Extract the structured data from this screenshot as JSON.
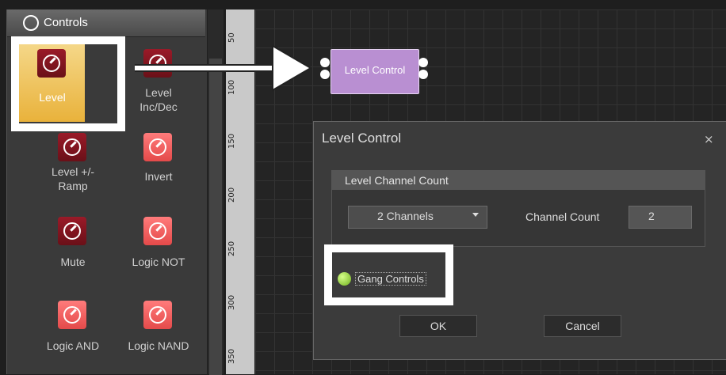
{
  "panel": {
    "title": "Controls",
    "tiles": [
      {
        "label": "Level",
        "icon": "level-knob-icon"
      },
      {
        "label": "Level\nInc/Dec",
        "icon": "level-knob-icon"
      },
      {
        "label": "Level +/-\nRamp",
        "icon": "level-knob-icon"
      },
      {
        "label": "Invert",
        "icon": "level-knob-icon"
      },
      {
        "label": "Mute",
        "icon": "level-knob-icon"
      },
      {
        "label": "Logic NOT",
        "icon": "level-knob-icon"
      },
      {
        "label": "Logic AND",
        "icon": "level-knob-icon"
      },
      {
        "label": "Logic NAND",
        "icon": "level-knob-icon"
      }
    ]
  },
  "ruler": {
    "ticks": [
      "50",
      "100",
      "150",
      "200",
      "250",
      "300",
      "350"
    ]
  },
  "canvas": {
    "node_label": "Level Control"
  },
  "dialog": {
    "title": "Level Control",
    "close": "×",
    "group_title": "Level Channel Count",
    "channels_value": "2 Channels",
    "channel_count_label": "Channel Count",
    "channel_count_value": "2",
    "gang_label": "Gang Controls",
    "ok_label": "OK",
    "cancel_label": "Cancel"
  },
  "colors": {
    "highlight": "#ffffff",
    "node": "#b98fd2",
    "selected_tile": "#e9b23b",
    "led": "#6fb01c"
  }
}
